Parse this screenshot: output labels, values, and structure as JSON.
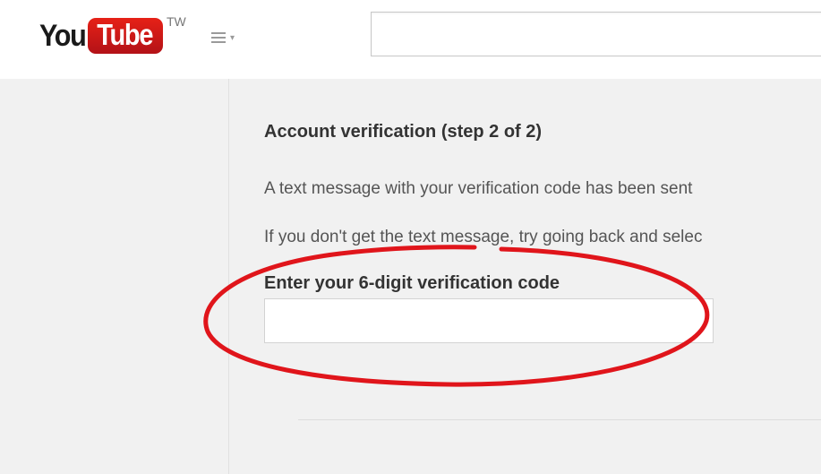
{
  "header": {
    "logo": {
      "you": "You",
      "tube": "Tube",
      "region": "TW"
    },
    "guide_icon": "hamburger-menu-icon",
    "search": {
      "value": "",
      "placeholder": ""
    }
  },
  "main": {
    "heading": "Account verification (step 2 of 2)",
    "message_sent": "A text message with your verification code has been sent",
    "message_retry": "If you don't get the text message, try going back and selec",
    "code_label": "Enter your 6-digit verification code",
    "code_input": {
      "value": "",
      "placeholder": ""
    }
  },
  "colors": {
    "brand_red": "#e62117",
    "annotation_red": "#e0151b",
    "page_background": "#f1f1f1",
    "heading_text": "#333333",
    "body_text": "#555555"
  }
}
